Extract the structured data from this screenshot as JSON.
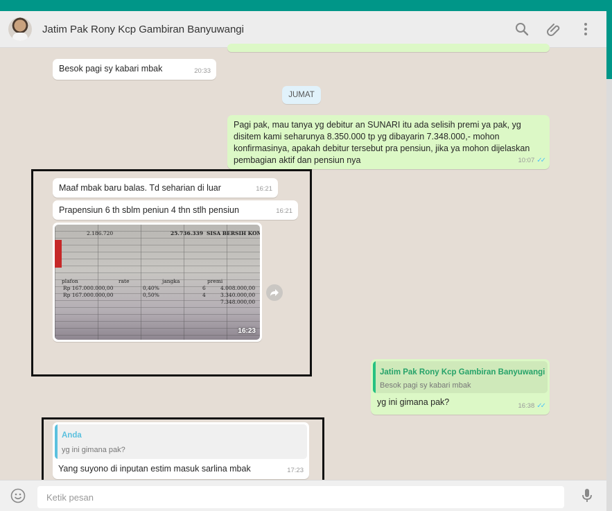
{
  "header": {
    "contact_name": "Jatim Pak Rony Kcp Gambiran Banyuwangi",
    "icons": [
      "search-icon",
      "attach-icon",
      "menu-icon"
    ]
  },
  "colors": {
    "brand": "#009688",
    "incoming_bubble": "#ffffff",
    "outgoing_bubble": "#dcf8c6",
    "read_ticks": "#4fc3f7",
    "quote_bar_out": "#26c281",
    "quote_bar_in": "#5bc0de"
  },
  "messages": {
    "m1": {
      "text": "Besok pagi sy kabari mbak",
      "time": "20:33"
    },
    "day_label": "JUMAT",
    "m2": {
      "lines": [
        "Pagi pak, mau tanya yg debitur an SUNARI itu ada selisih premi ya pak, yg",
        "disitem kami seharunya 8.350.000 tp yg dibayarin 7.348.000,- mohon",
        "konfirmasinya, apakah debitur tersebut pra pensiun, jika ya mohon dijelaskan",
        "pembagian aktif dan pensiun nya"
      ],
      "time": "10:07",
      "ticks": "✓✓"
    },
    "m3": {
      "text": "Maaf mbak baru balas. Td seharian di luar",
      "time": "16:21"
    },
    "m4": {
      "text": "Prapensiun 6 th sblm peniun 4 thn stlh pensiun",
      "time": "16:21"
    },
    "m5_photo": {
      "time": "16:23",
      "sheet": {
        "top_left": "2.186.720",
        "top_mid": "25.736.339",
        "top_right": "SISA BERSIH KOMPE",
        "headers": [
          "plafon",
          "rate",
          "jangka",
          "premi"
        ],
        "rows": [
          [
            "Rp 167.000.000,00",
            "0,40%",
            "6",
            "4.008.000,00"
          ],
          [
            "Rp 167.000.000,00",
            "0,50%",
            "4",
            "3.340.000,00"
          ],
          [
            "",
            "",
            "",
            "7.348.000,00"
          ]
        ]
      }
    },
    "m6": {
      "quote_name": "Jatim Pak Rony Kcp Gambiran Banyuwangi",
      "quote_text": "Besok pagi sy kabari mbak",
      "text": "yg ini gimana pak?",
      "time": "16:38",
      "ticks": "✓✓"
    },
    "m7": {
      "quote_name": "Anda",
      "quote_text": "yg ini gimana pak?",
      "text": "Yang suyono di inputan estim masuk sarlina mbak",
      "time": "17:23"
    }
  },
  "composer": {
    "placeholder": "Ketik pesan"
  }
}
